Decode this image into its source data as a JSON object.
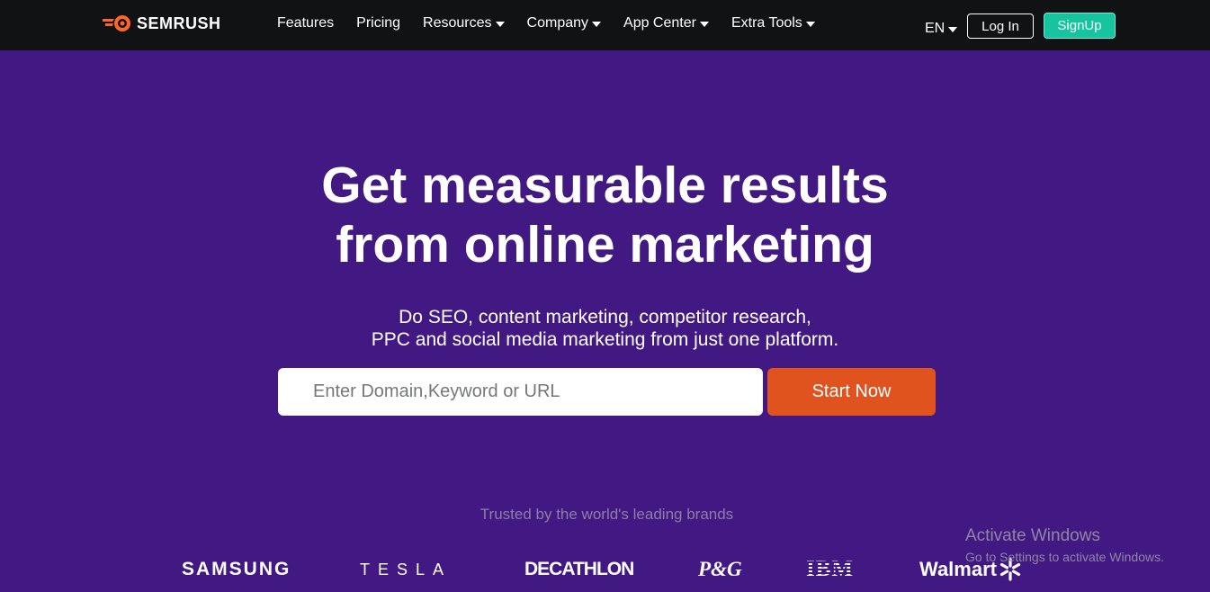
{
  "header": {
    "logo_text": "SEMRUSH",
    "nav": [
      {
        "label": "Features",
        "dropdown": false
      },
      {
        "label": "Pricing",
        "dropdown": false
      },
      {
        "label": "Resources",
        "dropdown": true
      },
      {
        "label": "Company",
        "dropdown": true
      },
      {
        "label": "App Center",
        "dropdown": true
      },
      {
        "label": "Extra Tools",
        "dropdown": true
      }
    ],
    "language": "EN",
    "login_label": "Log In",
    "signup_label": "SignUp"
  },
  "hero": {
    "headline_line1": "Get measurable results",
    "headline_line2": "from online marketing",
    "subtext_line1": "Do SEO, content marketing, competitor research,",
    "subtext_line2": "PPC and social media marketing from just one platform.",
    "search_placeholder": "Enter Domain,Keyword or URL",
    "start_label": "Start Now"
  },
  "trusted": {
    "heading": "Trusted by the world's leading brands",
    "brands": [
      "SAMSUNG",
      "TESLA",
      "DECATHLON",
      "P&G",
      "IBM",
      "Walmart"
    ]
  },
  "watermark": {
    "title": "Activate Windows",
    "subtitle": "Go to Settings to activate Windows."
  },
  "colors": {
    "header_bg": "#111214",
    "hero_bg": "#421983",
    "accent_orange": "#e0531f",
    "signup_green": "#16c49f"
  }
}
